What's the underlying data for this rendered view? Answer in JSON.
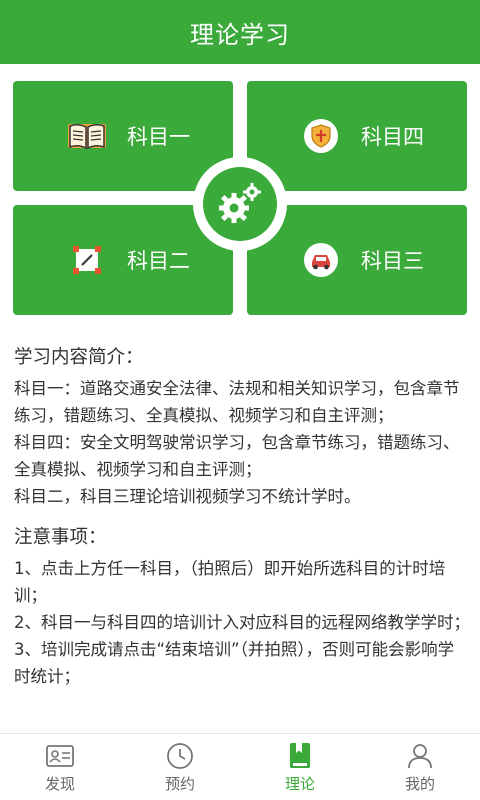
{
  "header": {
    "title": "理论学习"
  },
  "tiles": {
    "km1": {
      "label": "科目一",
      "icon": "book-icon"
    },
    "km4": {
      "label": "科目四",
      "icon": "shield-icon"
    },
    "km2": {
      "label": "科目二",
      "icon": "target-frame-icon"
    },
    "km3": {
      "label": "科目三",
      "icon": "car-icon"
    },
    "center_icon": "gears-icon"
  },
  "intro": {
    "title": "学习内容简介：",
    "lines": [
      "科目一：道路交通安全法律、法规和相关知识学习，包含章节练习，错题练习、全真模拟、视频学习和自主评测；",
      "科目四：安全文明驾驶常识学习，包含章节练习，错题练习、全真模拟、视频学习和自主评测；",
      "科目二，科目三理论培训视频学习不统计学时。"
    ]
  },
  "notes": {
    "title": "注意事项：",
    "lines": [
      "1、点击上方任一科目，（拍照后）即开始所选科目的计时培训；",
      "2、科目一与科目四的培训计入对应科目的远程网络教学学时；",
      "3、培训完成请点击“结束培训”（并拍照），否则可能会影响学时统计；"
    ]
  },
  "tabbar": {
    "items": [
      {
        "label": "发现",
        "icon": "id-card-icon",
        "active": false
      },
      {
        "label": "预约",
        "icon": "clock-icon",
        "active": false
      },
      {
        "label": "理论",
        "icon": "book-bookmark-icon",
        "active": true
      },
      {
        "label": "我的",
        "icon": "person-icon",
        "active": false
      }
    ]
  },
  "colors": {
    "primary": "#3aaa3a",
    "text": "#333333",
    "tab_inactive": "#666666"
  }
}
